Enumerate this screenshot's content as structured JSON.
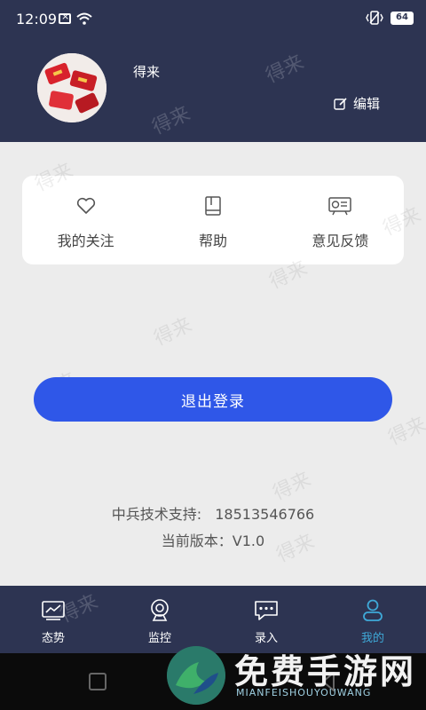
{
  "status_bar": {
    "time": "12:09",
    "battery": "64"
  },
  "profile": {
    "username": "得来",
    "edit_label": "编辑"
  },
  "quick_actions": [
    {
      "label": "我的关注",
      "icon": "heart-icon"
    },
    {
      "label": "帮助",
      "icon": "book-icon"
    },
    {
      "label": "意见反馈",
      "icon": "feedback-icon"
    }
  ],
  "logout_label": "退出登录",
  "support": {
    "label": "中兵技术支持:",
    "phone": "18513546766"
  },
  "version_text": "当前版本：V1.0",
  "watermark_text": "得来",
  "tabs": [
    {
      "label": "态势",
      "icon": "chart-icon",
      "active": false
    },
    {
      "label": "监控",
      "icon": "camera-icon",
      "active": false
    },
    {
      "label": "录入",
      "icon": "message-icon",
      "active": false
    },
    {
      "label": "我的",
      "icon": "user-icon",
      "active": true
    }
  ],
  "colors": {
    "header_bg": "#2d3452",
    "primary_button": "#2f57e8",
    "active_tab": "#3fa9d8",
    "page_bg": "#ececec"
  },
  "promo": {
    "title": "免费手游网",
    "subtitle": "MIANFEISHOUYOUWANG"
  }
}
